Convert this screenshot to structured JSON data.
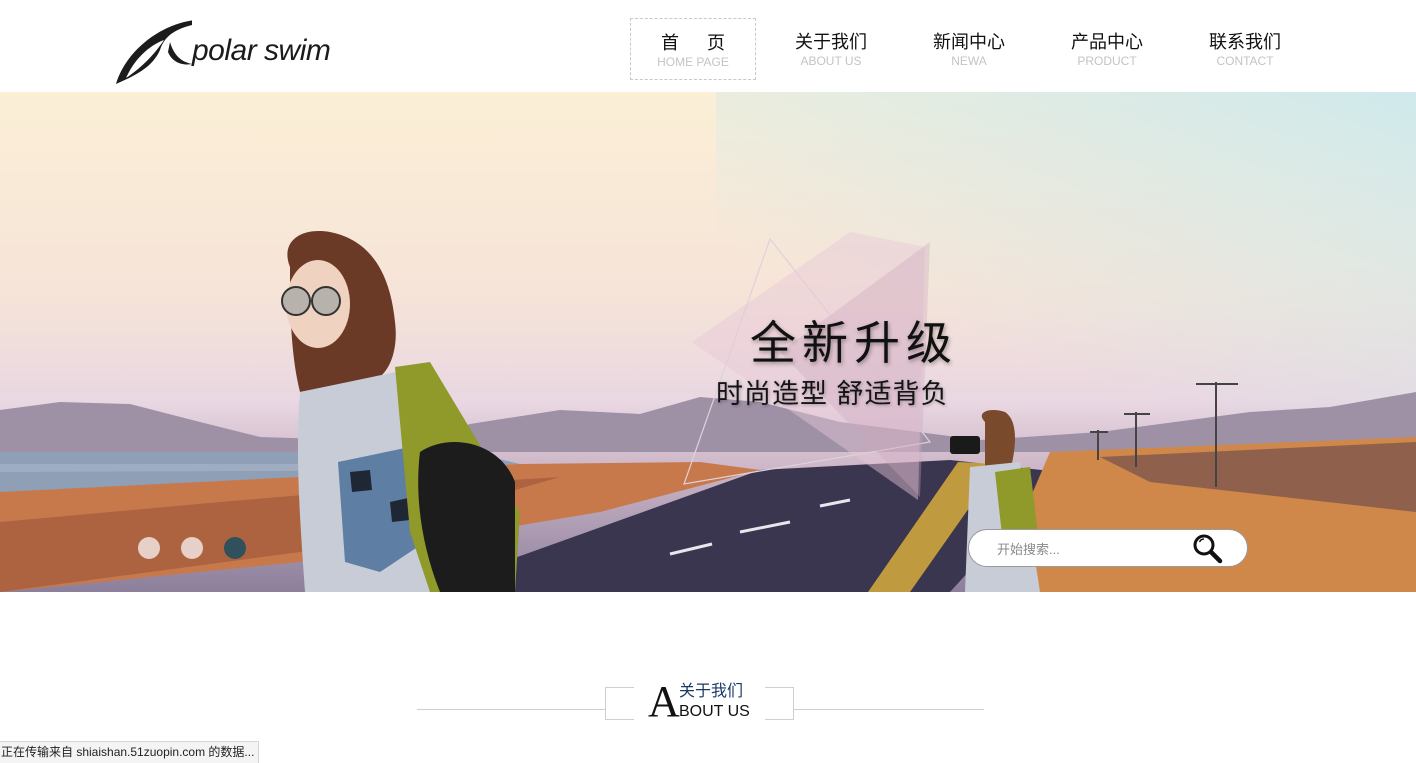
{
  "header": {
    "logo_text": "polar swim",
    "nav": [
      {
        "cn": "首页",
        "en": "HOME PAGE"
      },
      {
        "cn": "关于我们",
        "en": "ABOUT US"
      },
      {
        "cn": "新闻中心",
        "en": "NEWA"
      },
      {
        "cn": "产品中心",
        "en": "PRODUCT"
      },
      {
        "cn": "联系我们",
        "en": "CONTACT"
      }
    ],
    "active_index": 0
  },
  "banner": {
    "headline": "全新升级",
    "subline": "时尚造型 舒适背负",
    "slides": 3,
    "active_slide": 3,
    "search": {
      "placeholder": "开始搜索...",
      "icon": "magnifier-icon"
    }
  },
  "about": {
    "letter": "A",
    "cn": "关于我们",
    "en_rest": "BOUT US"
  },
  "status_bar": "正在传输来自 shiaishan.51zuopin.com 的数据..."
}
